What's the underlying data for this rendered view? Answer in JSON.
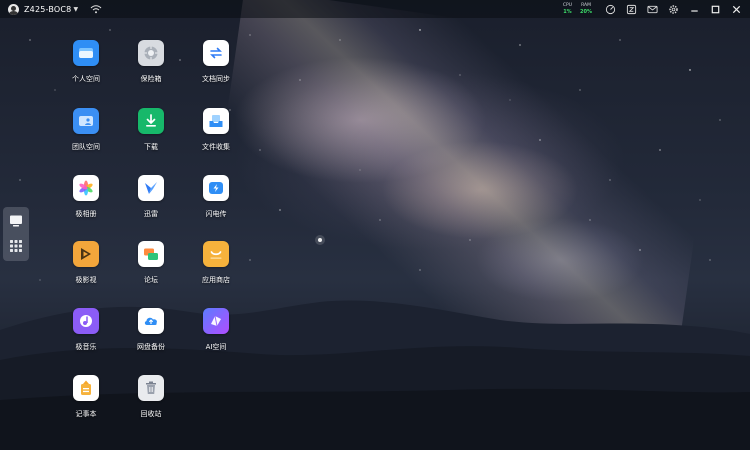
{
  "topbar": {
    "device_name": "Z425-BOC8",
    "cpu_label": "CPU",
    "cpu_value": "1%",
    "ram_label": "RAM",
    "ram_value": "20%",
    "icons": [
      "user-avatar-icon",
      "wifi-icon",
      "speedometer-icon",
      "shortcut-icon",
      "mail-icon",
      "settings-icon",
      "minimize-icon",
      "maximize-icon",
      "close-icon"
    ]
  },
  "dock": {
    "items": [
      "desktop-icon",
      "apps-grid-icon"
    ]
  },
  "apps": [
    {
      "label": "个人空间",
      "icon": "personal-space-icon",
      "color": "#2f8ef5"
    },
    {
      "label": "保险箱",
      "icon": "safe-box-icon",
      "color": "#d8dbe0"
    },
    {
      "label": "文档同步",
      "icon": "doc-sync-icon",
      "color": "#ffffff"
    },
    {
      "label": "团队空间",
      "icon": "team-space-icon",
      "color": "#3b8ff3"
    },
    {
      "label": "下载",
      "icon": "download-icon",
      "color": "#17b86a"
    },
    {
      "label": "文件收集",
      "icon": "file-collect-icon",
      "color": "#ffffff"
    },
    {
      "label": "极相册",
      "icon": "photos-icon",
      "color": "#ffffff"
    },
    {
      "label": "迅雷",
      "icon": "thunder-icon",
      "color": "#ffffff"
    },
    {
      "label": "闪电传",
      "icon": "flash-transfer-icon",
      "color": "#ffffff"
    },
    {
      "label": "极影视",
      "icon": "video-icon",
      "color": "#f3a63b"
    },
    {
      "label": "论坛",
      "icon": "forum-icon",
      "color": "#ffffff"
    },
    {
      "label": "应用商店",
      "icon": "app-store-icon",
      "color": "#f6b23c"
    },
    {
      "label": "极音乐",
      "icon": "music-icon",
      "color": "#8b5cf6"
    },
    {
      "label": "网盘备份",
      "icon": "cloud-backup-icon",
      "color": "#ffffff"
    },
    {
      "label": "AI空间",
      "icon": "ai-space-icon",
      "color": "#7c4dff"
    },
    {
      "label": "记事本",
      "icon": "notepad-icon",
      "color": "#ffffff"
    },
    {
      "label": "回收站",
      "icon": "recycle-bin-icon",
      "color": "#e9ebee"
    }
  ]
}
